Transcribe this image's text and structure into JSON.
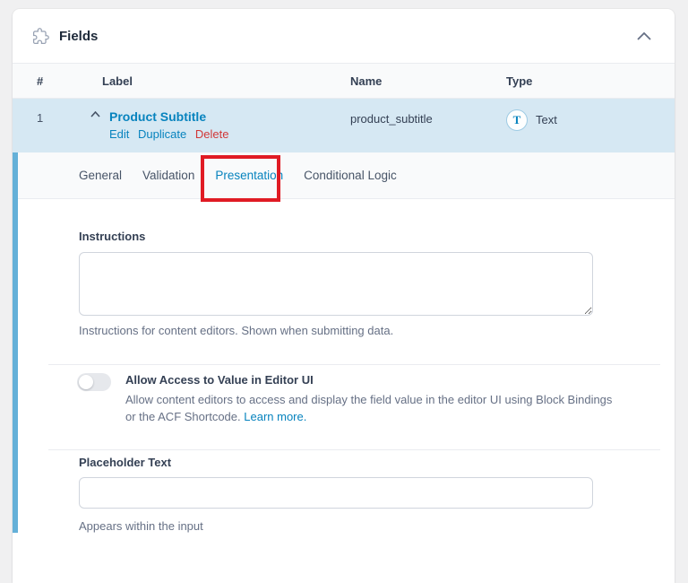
{
  "panel": {
    "title": "Fields"
  },
  "table": {
    "columns": [
      "#",
      "Label",
      "Name",
      "Type"
    ],
    "row": {
      "index": "1",
      "label": "Product Subtitle",
      "actions": {
        "edit": "Edit",
        "duplicate": "Duplicate",
        "delete": "Delete"
      },
      "name": "product_subtitle",
      "type_letter": "T",
      "type": "Text"
    }
  },
  "tabs": {
    "general": "General",
    "validation": "Validation",
    "presentation": "Presentation",
    "conditional_logic": "Conditional Logic",
    "active_tab": "Presentation"
  },
  "settings": {
    "instructions": {
      "label": "Instructions",
      "value": "",
      "help": "Instructions for content editors. Shown when submitting data."
    },
    "editor_access": {
      "label": "Allow Access to Value in Editor UI",
      "toggle_state": "off",
      "description": "Allow content editors to access and display the field value in the editor UI using Block Bindings or the ACF Shortcode.",
      "link": "Learn more."
    },
    "placeholder": {
      "label": "Placeholder Text",
      "value": "",
      "help": "Appears within the input"
    }
  },
  "colors": {
    "accent_blue": "#0783be",
    "delete_red": "#d13737",
    "annotation_red": "#e01b24",
    "open_field_bar": "#64b0d8",
    "row_highlight": "#d6e8f3"
  }
}
